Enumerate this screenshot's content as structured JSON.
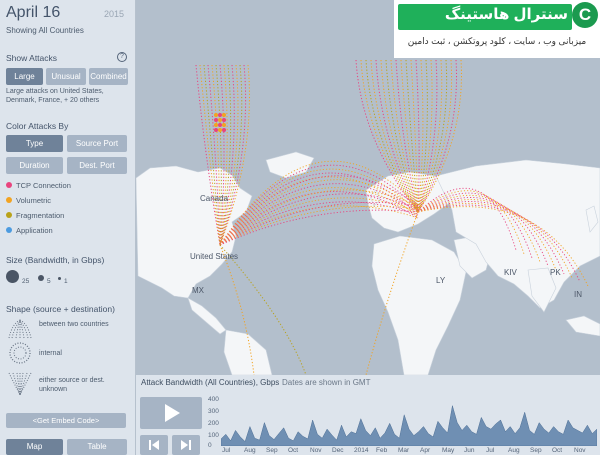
{
  "header": {
    "date": "April 16",
    "year": "2015",
    "subtitle": "Showing All Countries"
  },
  "show_attacks": {
    "title": "Show Attacks",
    "help_icon": "?",
    "options": [
      "Large",
      "Unusual",
      "Combined"
    ],
    "selected": "Large",
    "note": "Large attacks on United States, Denmark, France, + 20 others"
  },
  "color_by": {
    "title": "Color Attacks By",
    "options": [
      "Type",
      "Source Port",
      "Duration",
      "Dest. Port"
    ],
    "selected": "Type",
    "legend": [
      {
        "label": "TCP Connection",
        "color": "#e8447e"
      },
      {
        "label": "Volumetric",
        "color": "#f2a321"
      },
      {
        "label": "Fragmentation",
        "color": "#b9a21a"
      },
      {
        "label": "Application",
        "color": "#4c9be0"
      }
    ]
  },
  "size": {
    "title": "Size (Bandwidth, in Gbps)",
    "labels": [
      "25",
      "5",
      "1"
    ]
  },
  "shape": {
    "title": "Shape (source + destination)",
    "items": [
      "between two countries",
      "internal",
      "either source or dest. unknown"
    ]
  },
  "embed_label": "<Get Embed Code>",
  "view_tabs": [
    "Map",
    "Table"
  ],
  "map": {
    "labels": [
      "Canada",
      "United States",
      "MX",
      "KIV",
      "PK",
      "IN",
      "LY"
    ]
  },
  "logo": {
    "title": "سنترال هاستینگ",
    "tagline": "میزبانی وب ، سایت ، کلود پروتکشن ، ثبت دامین",
    "mark": "C"
  },
  "bandwidth": {
    "title": "Attack Bandwidth (All Countries), Gbps",
    "note": "Dates are shown in GMT",
    "y_ticks": [
      "400",
      "300",
      "200",
      "100",
      "0"
    ],
    "months": [
      "Jul",
      "Aug",
      "Sep",
      "Oct",
      "Nov",
      "Dec",
      "2014",
      "Feb",
      "Mar",
      "Apr",
      "May",
      "Jun",
      "Jul",
      "Aug",
      "Sep",
      "Oct",
      "Nov"
    ],
    "y_max": 400,
    "series_gbps": [
      55,
      90,
      40,
      120,
      70,
      35,
      150,
      60,
      45,
      180,
      80,
      50,
      95,
      140,
      60,
      40,
      110,
      75,
      55,
      200,
      90,
      60,
      130,
      85,
      45,
      160,
      70,
      110,
      95,
      210,
      120,
      80,
      140,
      60,
      100,
      175,
      90,
      60,
      240,
      130,
      80,
      110,
      150,
      95,
      70,
      190,
      140,
      100,
      310,
      180,
      120,
      160,
      110,
      90,
      220,
      150,
      130,
      170,
      200,
      110,
      150,
      95,
      140,
      260,
      120,
      90,
      180,
      130,
      100,
      150,
      110,
      90,
      200,
      140,
      120,
      100,
      160,
      95,
      130
    ]
  }
}
